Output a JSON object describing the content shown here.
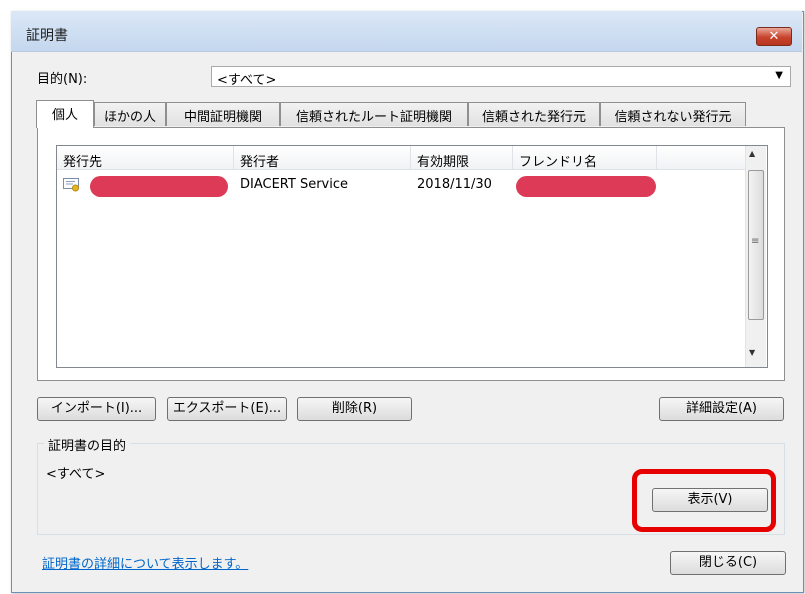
{
  "window": {
    "title": "証明書",
    "close_glyph": "✕"
  },
  "purpose": {
    "label": "目的(N):",
    "selected": "<すべて>"
  },
  "tabs": [
    {
      "label": "個人"
    },
    {
      "label": "ほかの人"
    },
    {
      "label": "中間証明機関"
    },
    {
      "label": "信頼されたルート証明機関"
    },
    {
      "label": "信頼された発行元"
    },
    {
      "label": "信頼されない発行元"
    }
  ],
  "table": {
    "columns": [
      "発行先",
      "発行者",
      "有効期限",
      "フレンドリ名"
    ],
    "rows": [
      {
        "issued_to": "",
        "issuer": "DIACERT Service",
        "expiry": "2018/11/30",
        "friendly_name": ""
      }
    ],
    "redaction_color": "#dd3a57"
  },
  "buttons": {
    "import": "インポート(I)...",
    "export": "エクスポート(E)...",
    "delete": "削除(R)",
    "advanced": "詳細設定(A)",
    "view": "表示(V)",
    "close": "閉じる(C)"
  },
  "purpose_group": {
    "caption": "証明書の目的",
    "value": "<すべて>"
  },
  "footer_link": "証明書の詳細について表示します。",
  "icons": {
    "certificate": "certificate-icon",
    "dropdown": "chevron-down-icon",
    "scroll_up": "scroll-up-arrow-icon",
    "scroll_down": "scroll-down-arrow-icon"
  },
  "colors": {
    "highlight": "#e60000",
    "link": "#0066cc",
    "close_button": "#c8432c"
  }
}
